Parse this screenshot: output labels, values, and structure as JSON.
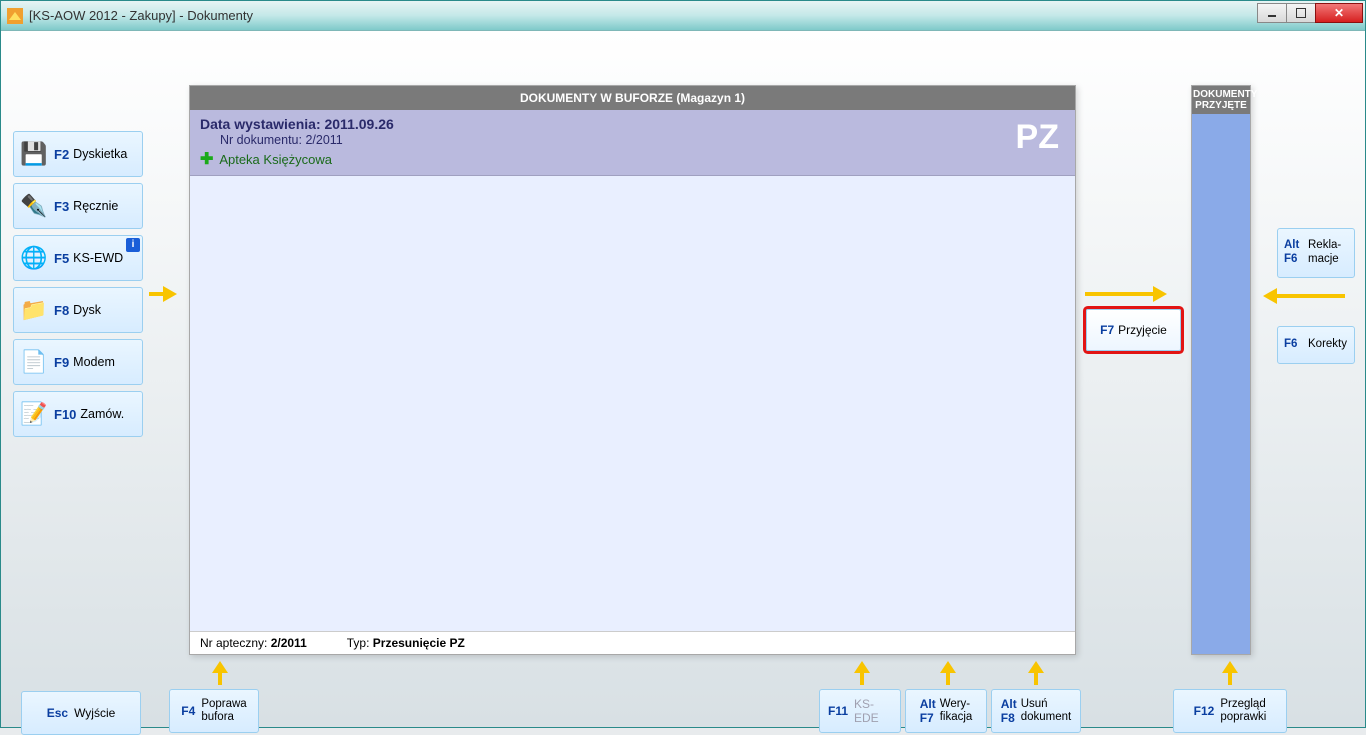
{
  "title": "[KS-AOW 2012 - Zakupy] - Dokumenty",
  "center": {
    "panel_title": "DOKUMENTY W BUFORZE (Magazyn 1)",
    "date_label": "Data wystawienia: 2011.09.26",
    "doc_nr_label": "Nr dokumentu: 2/2011",
    "pharmacy": "Apteka Księżycowa",
    "doc_type": "PZ",
    "footer_nr_label": "Nr apteczny:",
    "footer_nr": "2/2011",
    "footer_typ_label": "Typ:",
    "footer_typ": "Przesunięcie PZ"
  },
  "right_panel_head": "DOKUMENTY PRZYJĘTE",
  "left_tb": [
    {
      "key": "F2",
      "label": "Dyskietka",
      "icon": "💾"
    },
    {
      "key": "F3",
      "label": "Ręcznie",
      "icon": "✒️"
    },
    {
      "key": "F5",
      "label": "KS-EWD",
      "icon": "🌐",
      "info": true
    },
    {
      "key": "F8",
      "label": "Dysk",
      "icon": "📁"
    },
    {
      "key": "F9",
      "label": "Modem",
      "icon": "📄"
    },
    {
      "key": "F10",
      "label": "Zamów.",
      "icon": "📝"
    }
  ],
  "f7": {
    "key": "F7",
    "label": "Przyjęcie"
  },
  "right_tb": {
    "alt_key": "Alt",
    "alt_f6_key": "F6",
    "rekla": "Rekla-",
    "macje": "macje",
    "f6_key": "F6",
    "korekty": "Korekty"
  },
  "bottom": {
    "esc_key": "Esc",
    "esc": "Wyjście",
    "f4_key": "F4",
    "f4_l1": "Poprawa",
    "f4_l2": "bufora",
    "f11_key": "F11",
    "f11": "KS-EDE",
    "altf7_a": "Alt",
    "altf7_b": "F7",
    "altf7_l1": "Wery-",
    "altf7_l2": "fikacja",
    "altf8_a": "Alt",
    "altf8_b": "F8",
    "altf8_l1": "Usuń",
    "altf8_l2": "dokument",
    "f12_key": "F12",
    "f12_l1": "Przegląd",
    "f12_l2": "poprawki"
  }
}
